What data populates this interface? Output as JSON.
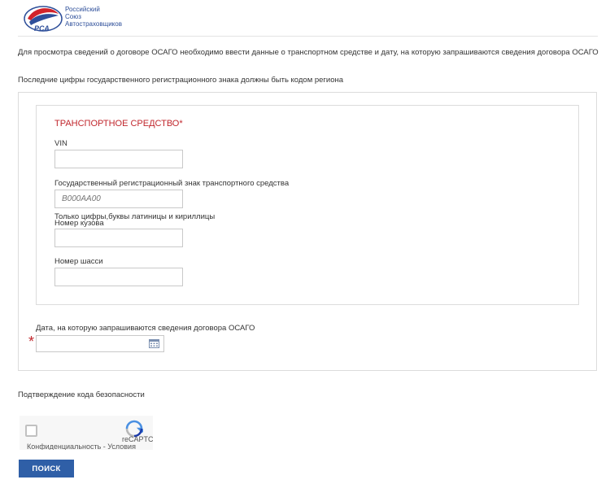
{
  "header": {
    "logo_lines": [
      "Российский",
      "Союз",
      "Автостраховщиков"
    ],
    "logo_mark": "РСА",
    "colors": {
      "blue": "#2e4f9a",
      "red": "#d2232a"
    }
  },
  "intro": {
    "text1": "Для просмотра сведений о договоре ОСАГО необходимо ввести данные о транспортном средстве и дату, на которую запрашиваются сведения договора ОСАГО",
    "text2": "Последние цифры государственного регистрационного знака должны быть кодом региона"
  },
  "vehicle": {
    "title": "ТРАНСПОРТНОЕ СРЕДСТВО*",
    "vin_label": "VIN",
    "vin_value": "",
    "reg_label": "Государственный регистрационный знак транспортного средства",
    "reg_placeholder": "В000АА00",
    "reg_hint": "Только цифры,буквы латиницы и кириллицы",
    "body_label": "Номер кузова",
    "body_value": "",
    "chassis_label": "Номер шасси",
    "chassis_value": ""
  },
  "date": {
    "label": "Дата, на которую запрашиваются сведения договора ОСАГО",
    "required_mark": "*",
    "value": "",
    "icon": "calendar-icon"
  },
  "captcha": {
    "label": "Подтверждение кода безопасности",
    "brand": "reCAPTCHA",
    "links": "Конфиденциальность - Условия"
  },
  "search_button": "ПОИСК",
  "colors": {
    "accent": "#2f5fa7",
    "required": "#c1272d"
  }
}
